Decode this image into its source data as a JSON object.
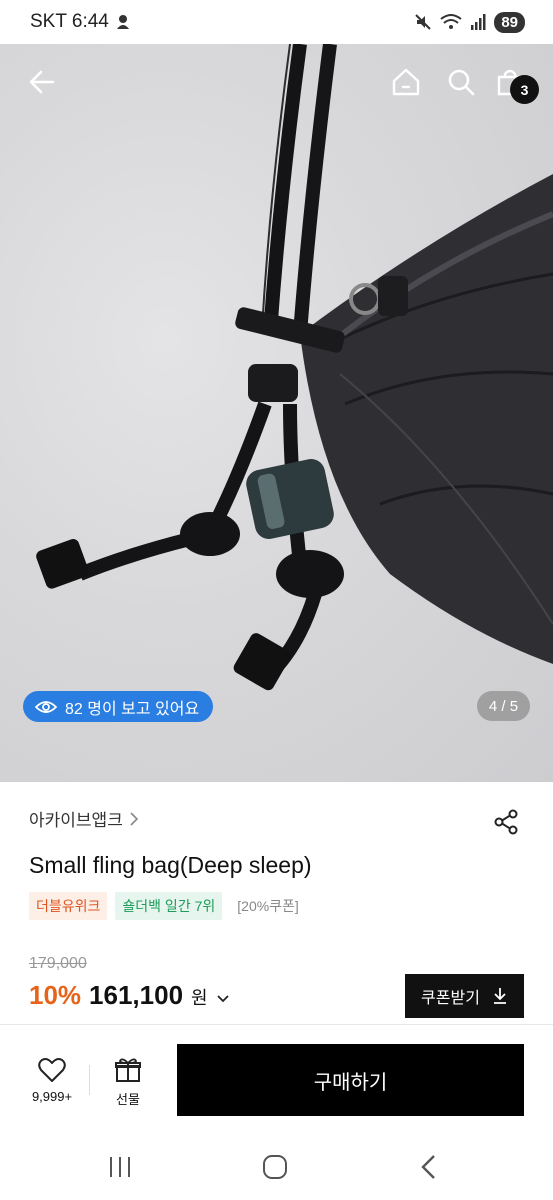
{
  "status_bar": {
    "carrier_time": "SKT 6:44",
    "battery": "89",
    "icons": [
      "mute-icon",
      "wifi-icon",
      "signal-icon"
    ]
  },
  "top_nav": {
    "icons": [
      "back-arrow-icon",
      "home-icon",
      "search-icon",
      "shopping-bag-icon"
    ],
    "cart_count": "3"
  },
  "hero": {
    "viewers_text": "82 명이 보고 있어요",
    "pager": "4 / 5"
  },
  "product": {
    "brand": "아카이브앱크",
    "title": "Small fling bag(Deep sleep)",
    "tags": [
      "더블유위크",
      "숄더백 일간 7위",
      "[20%쿠폰]"
    ],
    "original_price": "179,000",
    "discount": "10%",
    "price": "161,100",
    "currency": "원",
    "coupon_label": "쿠폰받기"
  },
  "bottom_bar": {
    "like_count": "9,999+",
    "gift_label": "선물",
    "buy_label": "구매하기"
  },
  "colors": {
    "accent_orange": "#e8631a",
    "viewer_blue": "#2a7de1",
    "tag_green": "#1e9c5a"
  }
}
